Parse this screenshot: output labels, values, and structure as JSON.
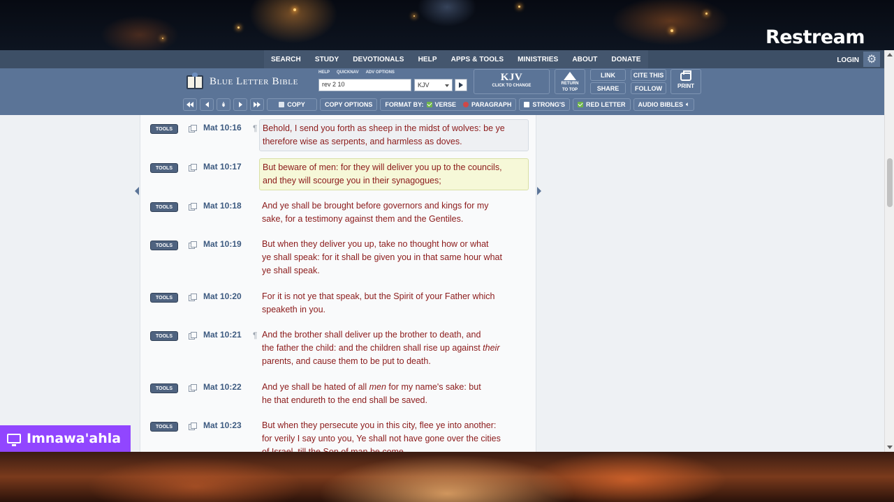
{
  "overlay": {
    "brand": "Restream",
    "streamer_name": "Imnawa'ahla"
  },
  "topnav": {
    "items": [
      "SEARCH",
      "STUDY",
      "DEVOTIONALS",
      "HELP",
      "APPS & TOOLS",
      "MINISTRIES",
      "ABOUT",
      "DONATE"
    ],
    "login": "LOGIN"
  },
  "header": {
    "logo_text": "Blue Letter Bible",
    "mini_labels": [
      "HELP",
      "QUICKNAV",
      "ADV OPTIONS"
    ],
    "search_value": "rev 2 10",
    "version_value": "KJV",
    "kjv_big": "KJV",
    "kjv_small": "CLICK TO CHANGE",
    "return_top": [
      "RETURN",
      "TO TOP"
    ],
    "link": "LINK",
    "share": "SHARE",
    "cite": "CITE THIS",
    "follow": "FOLLOW",
    "print": "PRINT"
  },
  "toolbar": {
    "copy": "COPY",
    "copy_options": "COPY OPTIONS",
    "format_by": "FORMAT BY:",
    "verse": "VERSE",
    "paragraph": "PARAGRAPH",
    "strongs": "STRONG'S",
    "red_letter": "RED LETTER",
    "audio_bibles": "AUDIO BIBLES"
  },
  "tools_label": "TOOLS",
  "verses": [
    {
      "ref": "Mat 10:16",
      "para": true,
      "lines": [
        "Behold, I send you forth as sheep in the midst of wolves: be ye",
        "therefore wise as serpents, and harmless as doves."
      ],
      "highlight": "grey"
    },
    {
      "ref": "Mat 10:17",
      "para": false,
      "lines": [
        "But beware of men: for they will deliver you up to the councils,",
        "and they will scourge you in their synagogues;"
      ],
      "highlight": "yellow"
    },
    {
      "ref": "Mat 10:18",
      "para": false,
      "lines": [
        "And ye shall be brought before governors and kings for my",
        "sake, for a testimony against them and the Gentiles."
      ],
      "highlight": "none"
    },
    {
      "ref": "Mat 10:19",
      "para": false,
      "lines": [
        "But when they deliver you up, take no thought how or what",
        "ye shall speak: for it shall be given you in that same hour what",
        "ye shall speak."
      ],
      "highlight": "none"
    },
    {
      "ref": "Mat 10:20",
      "para": false,
      "lines": [
        "For it is not ye that speak, but the Spirit of your Father which",
        "speaketh in you."
      ],
      "highlight": "none"
    },
    {
      "ref": "Mat 10:21",
      "para": true,
      "lines": [
        "And the brother shall deliver up the brother to death, and",
        "the father the child: and the children shall rise up against their",
        "parents, and cause them to be put to death."
      ],
      "highlight": "none"
    },
    {
      "ref": "Mat 10:22",
      "para": false,
      "lines": [
        "And ye shall be hated of all men for my name's sake: but",
        "he that endureth to the end shall be saved."
      ],
      "highlight": "none"
    },
    {
      "ref": "Mat 10:23",
      "para": false,
      "lines": [
        "But when they persecute you in this city, flee ye into another:",
        "for verily I say unto you, Ye shall not have gone over the cities",
        "of Israel, till the Son of man be come."
      ],
      "highlight": "none"
    }
  ],
  "colors": {
    "nav_bg": "#3d4f66",
    "header_bg": "#5b7497",
    "red_letter": "#8b1a1a",
    "ref_blue": "#3d5a80",
    "stream_purple": "#9146ff"
  }
}
